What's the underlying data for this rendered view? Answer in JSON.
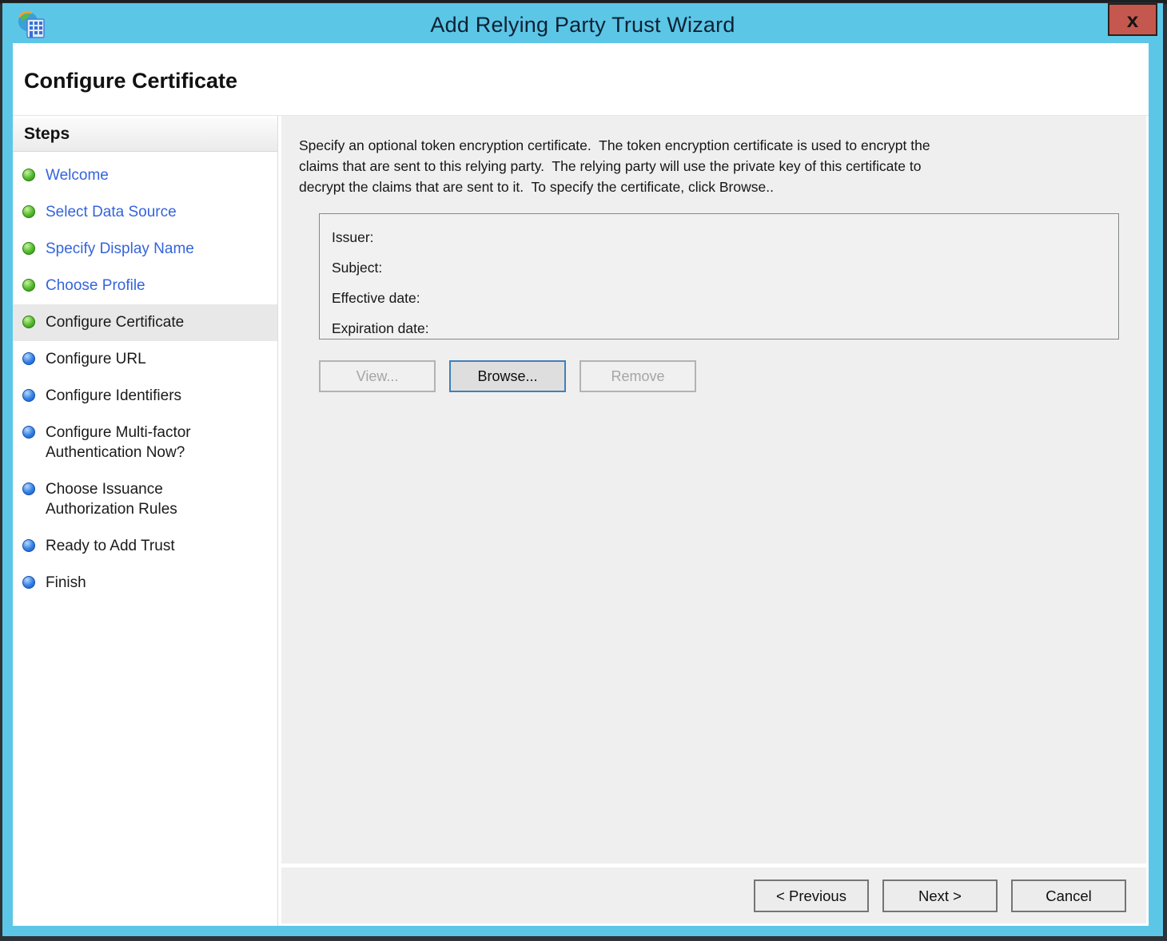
{
  "window": {
    "title": "Add Relying Party Trust Wizard",
    "close_glyph": "x"
  },
  "header": {
    "title": "Configure Certificate"
  },
  "sidebar": {
    "heading": "Steps",
    "steps": [
      {
        "label": "Welcome",
        "state": "completed"
      },
      {
        "label": "Select Data Source",
        "state": "completed"
      },
      {
        "label": "Specify Display Name",
        "state": "completed"
      },
      {
        "label": "Choose Profile",
        "state": "completed"
      },
      {
        "label": "Configure Certificate",
        "state": "current"
      },
      {
        "label": "Configure URL",
        "state": "upcoming"
      },
      {
        "label": "Configure Identifiers",
        "state": "upcoming"
      },
      {
        "label": "Configure Multi-factor\nAuthentication Now?",
        "state": "upcoming"
      },
      {
        "label": "Choose Issuance\nAuthorization Rules",
        "state": "upcoming"
      },
      {
        "label": "Ready to Add Trust",
        "state": "upcoming"
      },
      {
        "label": "Finish",
        "state": "upcoming"
      }
    ]
  },
  "main": {
    "description": "Specify an optional token encryption certificate.  The token encryption certificate is used to encrypt the\nclaims that are sent to this relying party.  The relying party will use the private key of this certificate to\ndecrypt the claims that are sent to it.  To specify the certificate, click Browse..",
    "certificate_fields": [
      {
        "label": "Issuer:"
      },
      {
        "label": "Subject:"
      },
      {
        "label": "Effective date:"
      },
      {
        "label": "Expiration date:"
      }
    ],
    "buttons": {
      "view": "View...",
      "browse": "Browse...",
      "remove": "Remove"
    }
  },
  "footer": {
    "previous": "< Previous",
    "next": "Next >",
    "cancel": "Cancel"
  },
  "colors": {
    "titlebar": "#5cc6e7",
    "close_button": "#c4584e",
    "link_blue": "#3464dc",
    "dot_green": "#3fae21",
    "dot_blue": "#2f7de0",
    "panel_gray": "#f0efef",
    "browse_focus_border": "#3e80ba"
  }
}
